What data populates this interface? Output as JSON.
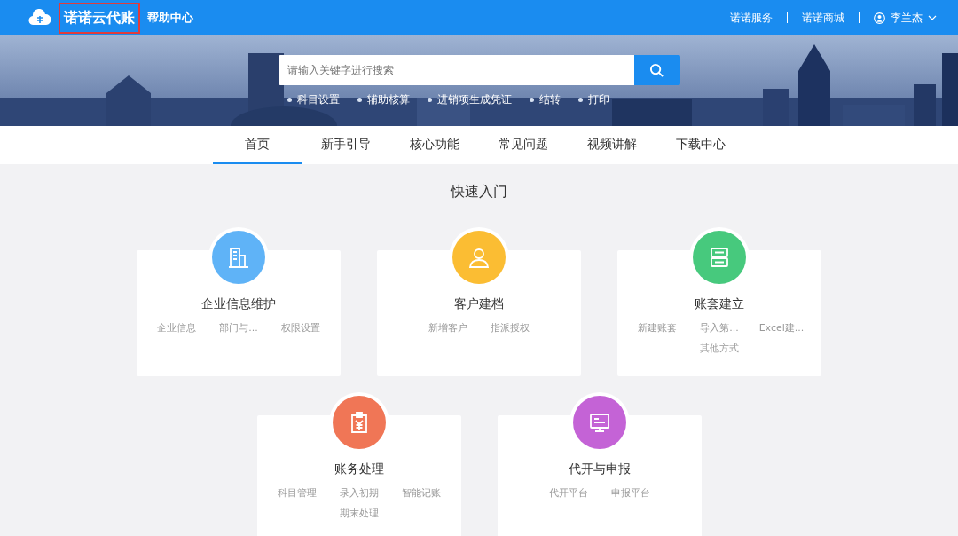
{
  "header": {
    "logo_text": "诺诺云代账",
    "logo_highlighted": true,
    "subtitle": "帮助中心",
    "links": [
      "诺诺服务",
      "诺诺商城"
    ],
    "user": "李兰杰"
  },
  "search": {
    "placeholder": "请输入关键字进行搜索"
  },
  "quick_links": [
    "科目设置",
    "辅助核算",
    "进销项生成凭证",
    "结转",
    "打印"
  ],
  "tabs": [
    {
      "label": "首页",
      "selected": true
    },
    {
      "label": "新手引导",
      "selected": false
    },
    {
      "label": "核心功能",
      "selected": false
    },
    {
      "label": "常见问题",
      "selected": false
    },
    {
      "label": "视频讲解",
      "selected": false
    },
    {
      "label": "下载中心",
      "selected": false
    }
  ],
  "section_title": "快速入门",
  "cards": [
    {
      "title": "企业信息维护",
      "kind": "building",
      "color": "#5fb3f7",
      "items": [
        "企业信息",
        "部门与...",
        "权限设置"
      ]
    },
    {
      "title": "客户建档",
      "kind": "person",
      "color": "#fbbd33",
      "items": [
        "新增客户",
        "指派授权"
      ]
    },
    {
      "title": "账套建立",
      "kind": "server",
      "color": "#47c97d",
      "items": [
        "新建账套",
        "导入第...",
        "Excel建...",
        "其他方式"
      ]
    },
    {
      "title": "账务处理",
      "kind": "receipt",
      "color": "#f07656",
      "items": [
        "科目管理",
        "录入初期",
        "智能记账",
        "期末处理"
      ]
    },
    {
      "title": "代开与申报",
      "kind": "monitor",
      "color": "#c463d6",
      "items": [
        "代开平台",
        "申报平台"
      ]
    }
  ]
}
